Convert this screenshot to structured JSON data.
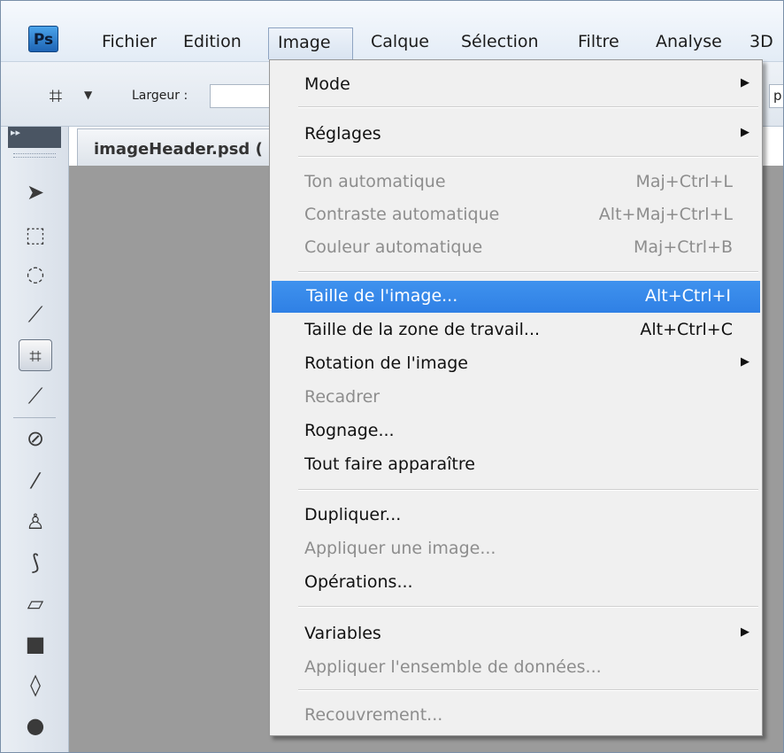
{
  "app": {
    "logo_text": "Ps"
  },
  "menubar": {
    "items": [
      "Fichier",
      "Edition",
      "Image",
      "Calque",
      "Sélection",
      "Filtre",
      "Analyse",
      "3D"
    ]
  },
  "options_bar": {
    "largeur_label": "Largeur :",
    "largeur_value": "",
    "right_field_partial": "p"
  },
  "document": {
    "tab_title": "imageHeader.psd ("
  },
  "image_menu": {
    "items": [
      {
        "label": "Mode",
        "shortcut": "",
        "submenu": true,
        "disabled": false,
        "highlighted": false
      },
      {
        "label": "Réglages",
        "shortcut": "",
        "submenu": true,
        "disabled": false,
        "highlighted": false
      },
      {
        "label": "Ton automatique",
        "shortcut": "Maj+Ctrl+L",
        "submenu": false,
        "disabled": true,
        "highlighted": false
      },
      {
        "label": "Contraste automatique",
        "shortcut": "Alt+Maj+Ctrl+L",
        "submenu": false,
        "disabled": true,
        "highlighted": false
      },
      {
        "label": "Couleur automatique",
        "shortcut": "Maj+Ctrl+B",
        "submenu": false,
        "disabled": true,
        "highlighted": false
      },
      {
        "label": "Taille de l'image...",
        "shortcut": "Alt+Ctrl+I",
        "submenu": false,
        "disabled": false,
        "highlighted": true
      },
      {
        "label": "Taille de la zone de travail...",
        "shortcut": "Alt+Ctrl+C",
        "submenu": false,
        "disabled": false,
        "highlighted": false
      },
      {
        "label": "Rotation de l'image",
        "shortcut": "",
        "submenu": true,
        "disabled": false,
        "highlighted": false
      },
      {
        "label": "Recadrer",
        "shortcut": "",
        "submenu": false,
        "disabled": true,
        "highlighted": false
      },
      {
        "label": "Rognage...",
        "shortcut": "",
        "submenu": false,
        "disabled": false,
        "highlighted": false
      },
      {
        "label": "Tout faire apparaître",
        "shortcut": "",
        "submenu": false,
        "disabled": false,
        "highlighted": false
      },
      {
        "label": "Dupliquer...",
        "shortcut": "",
        "submenu": false,
        "disabled": false,
        "highlighted": false
      },
      {
        "label": "Appliquer une image...",
        "shortcut": "",
        "submenu": false,
        "disabled": true,
        "highlighted": false
      },
      {
        "label": "Opérations...",
        "shortcut": "",
        "submenu": false,
        "disabled": false,
        "highlighted": false
      },
      {
        "label": "Variables",
        "shortcut": "",
        "submenu": true,
        "disabled": false,
        "highlighted": false
      },
      {
        "label": "Appliquer l'ensemble de données...",
        "shortcut": "",
        "submenu": false,
        "disabled": true,
        "highlighted": false
      },
      {
        "label": "Recouvrement...",
        "shortcut": "",
        "submenu": false,
        "disabled": true,
        "highlighted": false
      }
    ]
  },
  "toolbox": {
    "tools": [
      "move-tool-icon",
      "marquee-tool-icon",
      "lasso-tool-icon",
      "quick-selection-tool-icon",
      "crop-tool-icon",
      "eyedropper-tool-icon",
      "healing-brush-tool-icon",
      "brush-tool-icon",
      "clone-stamp-tool-icon",
      "history-brush-tool-icon",
      "eraser-tool-icon",
      "gradient-tool-icon",
      "blur-tool-icon",
      "dodge-tool-icon"
    ],
    "selected_tool": "crop-tool-icon"
  },
  "colors": {
    "highlight": "#3388ea",
    "disabled_text": "#8d8d8d",
    "canvas_bg": "#9b9b9b"
  }
}
